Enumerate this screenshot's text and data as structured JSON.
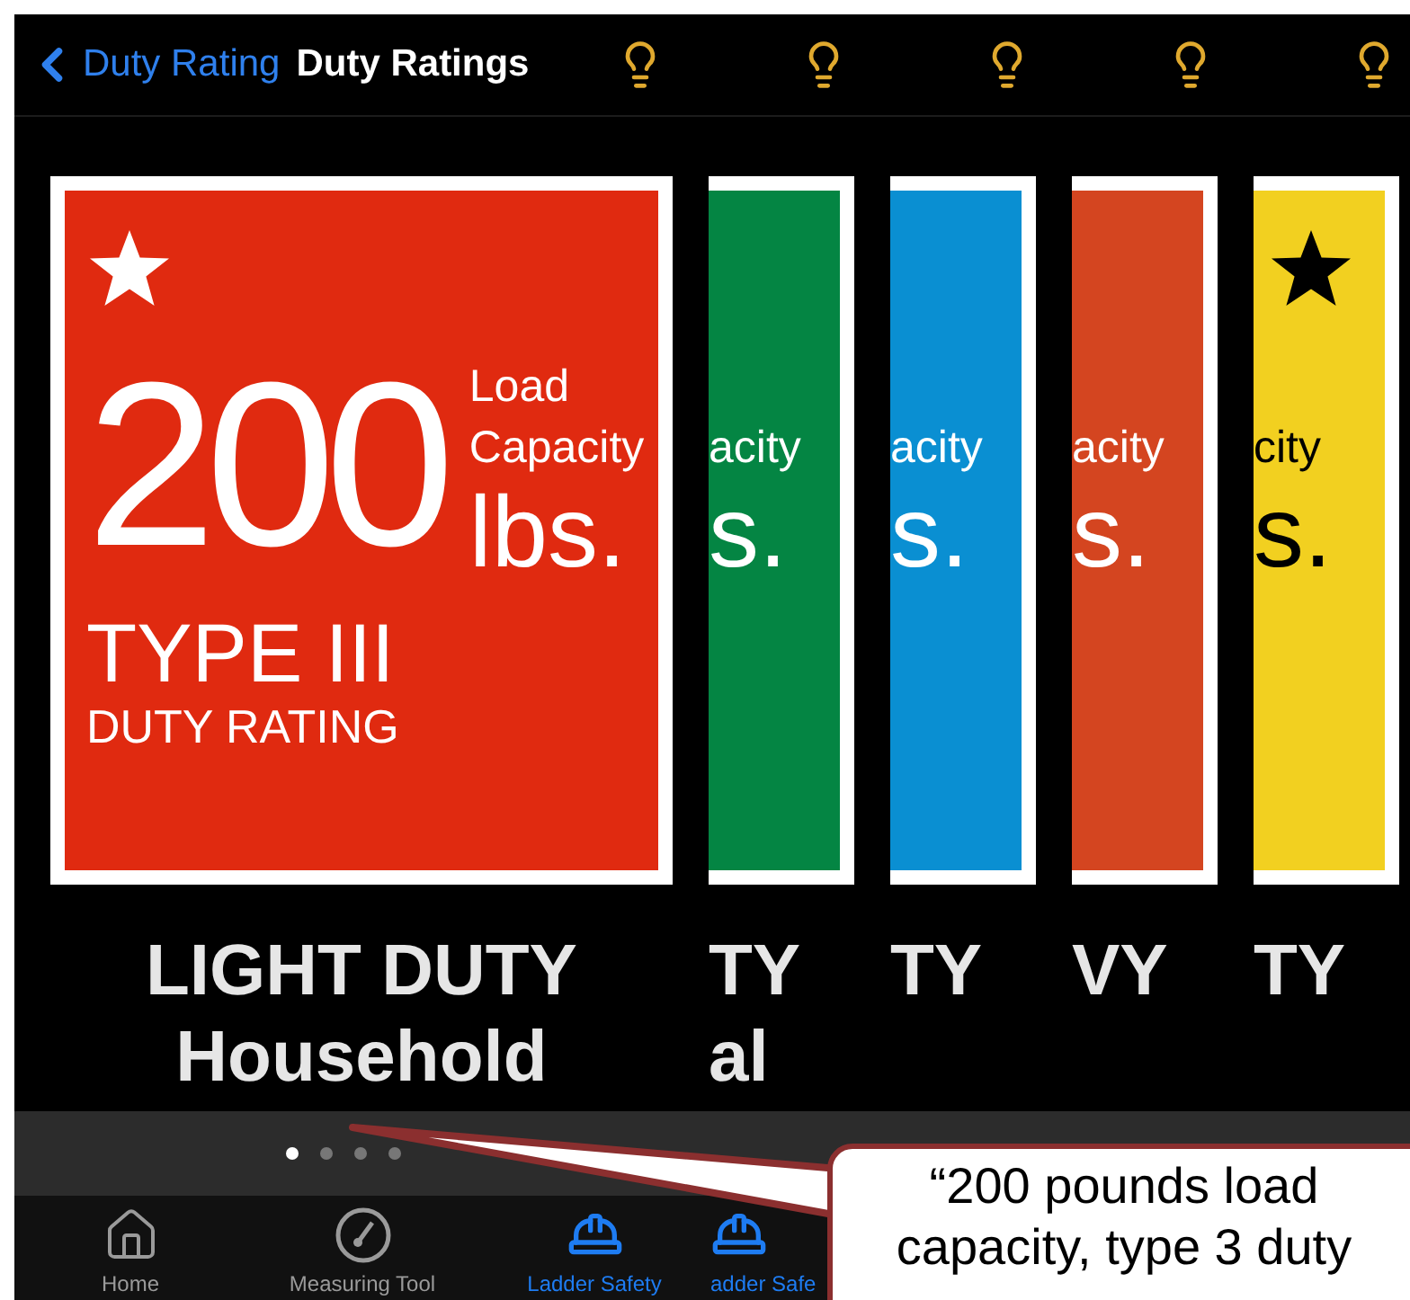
{
  "nav": {
    "back_label": "Duty Rating",
    "title": "Duty Ratings"
  },
  "cards": [
    {
      "kind": "full",
      "color": "#e02a10",
      "dark_text": false,
      "star": true,
      "number": "200",
      "load": "Load",
      "capacity": "Capacity",
      "unit": "lbs.",
      "type": "TYPE III",
      "rating": "DUTY RATING",
      "title": "LIGHT DUTY",
      "subtitle": "Household"
    },
    {
      "kind": "peek",
      "color": "#048543",
      "dark_text": false,
      "star": false,
      "capacity": "acity",
      "unit": "s.",
      "title": "TY",
      "subtitle": "al"
    },
    {
      "kind": "peek",
      "color": "#0a8fd2",
      "dark_text": false,
      "star": false,
      "capacity": "acity",
      "unit": "s.",
      "title": "TY"
    },
    {
      "kind": "peek",
      "color": "#d44520",
      "dark_text": false,
      "star": false,
      "capacity": "acity",
      "unit": "s.",
      "title": "VY"
    },
    {
      "kind": "peek",
      "color": "#f2d020",
      "dark_text": true,
      "star": true,
      "capacity": "city",
      "unit": "s.",
      "title": "TY"
    }
  ],
  "page_dots": [
    {
      "selected": true
    },
    {
      "selected": false
    },
    {
      "selected": false
    },
    {
      "selected": false
    }
  ],
  "tabs": [
    {
      "label": "Home",
      "selected": false
    },
    {
      "label": "Measuring Tool",
      "selected": false
    },
    {
      "label": "Ladder Safety",
      "selected": true
    },
    {
      "label": "adder Safe",
      "selected": true
    }
  ],
  "callout": {
    "text": "“200 pounds load capacity,  type 3 duty"
  }
}
